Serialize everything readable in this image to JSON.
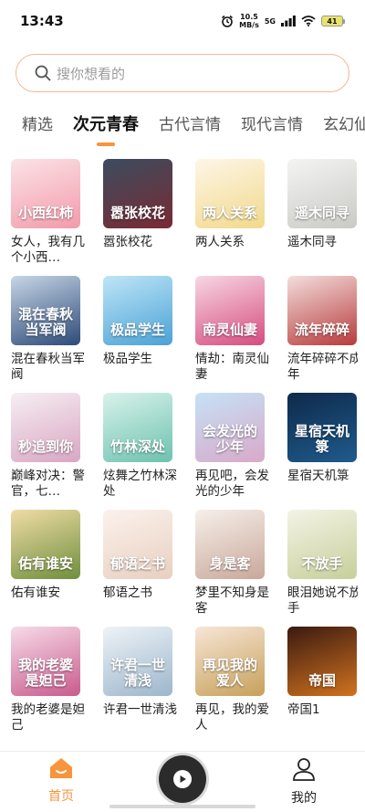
{
  "status_bar": {
    "time": "13:43",
    "net_speed_value": "10.5",
    "net_speed_unit": "MB/s",
    "network": "5G",
    "battery": "41"
  },
  "search": {
    "placeholder": "搜你想看的"
  },
  "tabs": [
    {
      "label": "精选",
      "active": false
    },
    {
      "label": "次元青春",
      "active": true
    },
    {
      "label": "古代言情",
      "active": false
    },
    {
      "label": "现代言情",
      "active": false
    },
    {
      "label": "玄幻仙侠",
      "active": false
    }
  ],
  "books": [
    {
      "title": "女人，我有几个小西…",
      "cover_text": "小西红柿",
      "cover_colors": [
        "#fbe3e6",
        "#f39aab"
      ]
    },
    {
      "title": "嚣张校花",
      "cover_text": "嚣张校花",
      "cover_colors": [
        "#3a4d5e",
        "#7a2a35"
      ]
    },
    {
      "title": "两人关系",
      "cover_text": "两人关系",
      "cover_colors": [
        "#fdf6e8",
        "#f2d98a"
      ]
    },
    {
      "title": "遥木同寻",
      "cover_text": "遥木同寻",
      "cover_colors": [
        "#f4f4f2",
        "#c9c9c6"
      ]
    },
    {
      "title": "混在春秋当军阀",
      "cover_text": "混在春秋当军阀",
      "cover_colors": [
        "#c7d6e6",
        "#2d4a78"
      ]
    },
    {
      "title": "极品学生",
      "cover_text": "极品学生",
      "cover_colors": [
        "#bfe5f7",
        "#4aa2d6"
      ]
    },
    {
      "title": "情劫：南灵仙妻",
      "cover_text": "南灵仙妻",
      "cover_colors": [
        "#f7d7e3",
        "#d64c7f"
      ]
    },
    {
      "title": "流年碎碎不成年",
      "cover_text": "流年碎碎",
      "cover_colors": [
        "#f3dedd",
        "#b83b3b"
      ]
    },
    {
      "title": "巅峰对决：警官，七…",
      "cover_text": "秒追到你",
      "cover_colors": [
        "#f6eef3",
        "#d9a6c3"
      ]
    },
    {
      "title": "炫舞之竹林深处",
      "cover_text": "竹林深处",
      "cover_colors": [
        "#d9f2ea",
        "#6cc2b0"
      ]
    },
    {
      "title": "再见吧，会发光的少年",
      "cover_text": "会发光的少年",
      "cover_colors": [
        "#c5e2f6",
        "#d8a9c9"
      ]
    },
    {
      "title": "星宿天机箓",
      "cover_text": "星宿天机箓",
      "cover_colors": [
        "#0e2a4a",
        "#1f5b8d"
      ]
    },
    {
      "title": "佑有谁安",
      "cover_text": "佑有谁安",
      "cover_colors": [
        "#f0dca6",
        "#6f8f3d"
      ]
    },
    {
      "title": "郁语之书",
      "cover_text": "郁语之书",
      "cover_colors": [
        "#fbf2ec",
        "#e8cfc0"
      ]
    },
    {
      "title": "梦里不知身是客",
      "cover_text": "身是客",
      "cover_colors": [
        "#f6f0ea",
        "#c9a79a"
      ]
    },
    {
      "title": "眼泪她说不放手",
      "cover_text": "不放手",
      "cover_colors": [
        "#f3f4e6",
        "#c7cf9a"
      ]
    },
    {
      "title": "我的老婆是妲己",
      "cover_text": "我的老婆是妲己",
      "cover_colors": [
        "#f7dbe8",
        "#c85b8d"
      ]
    },
    {
      "title": "许君一世清浅",
      "cover_text": "许君一世清浅",
      "cover_colors": [
        "#eef3f7",
        "#9cb6cc"
      ]
    },
    {
      "title": "再见，我的爱人",
      "cover_text": "再见我的爱人",
      "cover_colors": [
        "#f7e6d6",
        "#c7a05a"
      ]
    },
    {
      "title": "帝国1",
      "cover_text": "帝国",
      "cover_colors": [
        "#3a1a10",
        "#d2721f"
      ]
    }
  ],
  "bottom_nav": {
    "home_label": "首页",
    "mine_label": "我的"
  },
  "colors": {
    "accent": "#f7943c",
    "search_border": "#f5b995"
  }
}
